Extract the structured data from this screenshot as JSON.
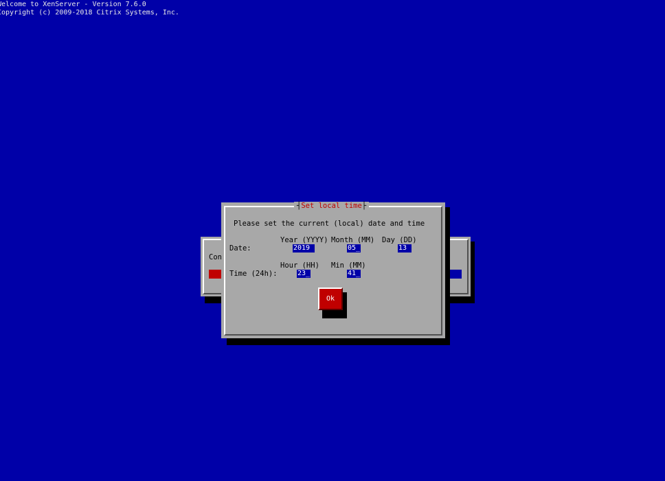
{
  "banner": {
    "line1": "Welcome to XenServer - Version 7.6.0",
    "line2": "Copyright (c) 2009-2018 Citrix Systems, Inc."
  },
  "background_dialog": {
    "label": "Con"
  },
  "dialog": {
    "title": "Set local time",
    "prompt": "Please set the current (local) date and time",
    "date": {
      "row_label": "Date:",
      "year_label": "Year (YYYY)",
      "month_label": "Month (MM)",
      "day_label": "Day (DD)",
      "year_value": "2019",
      "month_value": "05_",
      "day_value": "13"
    },
    "time": {
      "row_label": "Time (24h):",
      "hour_label": "Hour (HH)",
      "min_label": "Min (MM)",
      "hour_value": "23_",
      "min_value": "41_"
    },
    "ok_label": "Ok"
  },
  "colors": {
    "screen_background": "#0000a8",
    "dialog_background": "#a8a8a8",
    "title_text": "#c00000",
    "button_background": "#c00000",
    "field_background": "#0000a8"
  }
}
